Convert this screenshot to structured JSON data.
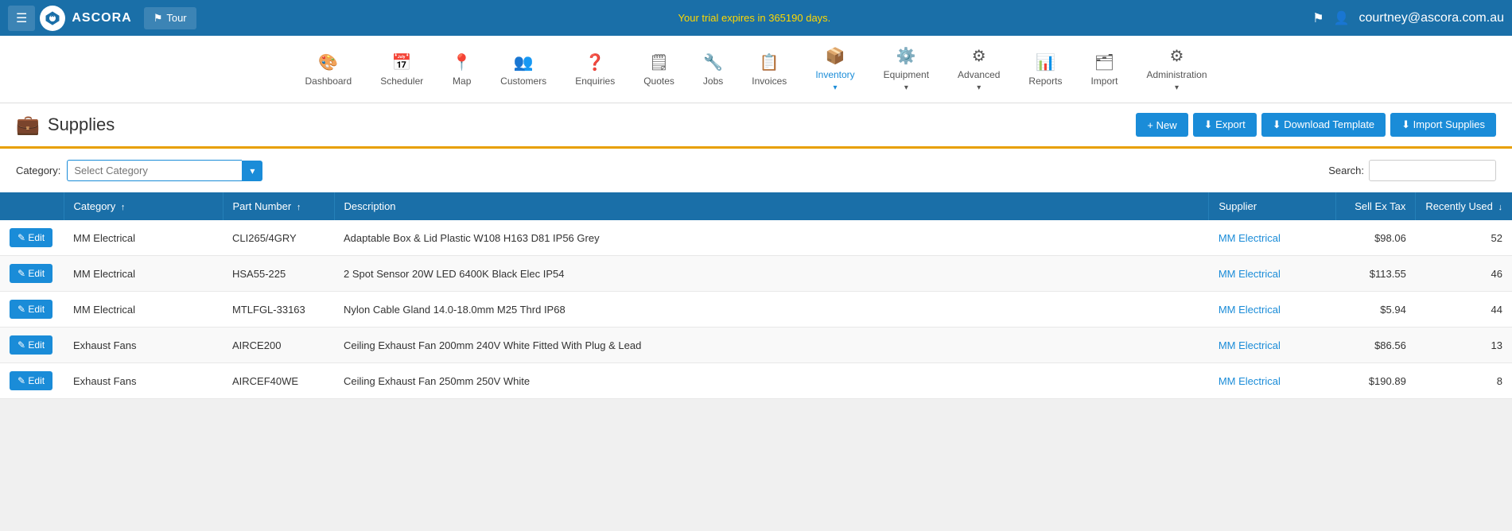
{
  "topnav": {
    "logo_text": "Ascora",
    "hamburger_label": "☰",
    "tour_label": "Tour",
    "trial_notice": "Your trial expires in 365190 days.",
    "flag_icon": "⚑",
    "user_icon": "👤",
    "user_email": "courtney@ascora.com.au"
  },
  "secondnav": {
    "items": [
      {
        "id": "dashboard",
        "icon": "🎨",
        "label": "Dashboard",
        "active": false,
        "dropdown": false
      },
      {
        "id": "scheduler",
        "icon": "📅",
        "label": "Scheduler",
        "active": false,
        "dropdown": false
      },
      {
        "id": "map",
        "icon": "📍",
        "label": "Map",
        "active": false,
        "dropdown": false
      },
      {
        "id": "customers",
        "icon": "👥",
        "label": "Customers",
        "active": false,
        "dropdown": false
      },
      {
        "id": "enquiries",
        "icon": "❓",
        "label": "Enquiries",
        "active": false,
        "dropdown": false
      },
      {
        "id": "quotes",
        "icon": "🗒",
        "label": "Quotes",
        "active": false,
        "dropdown": false
      },
      {
        "id": "jobs",
        "icon": "🔧",
        "label": "Jobs",
        "active": false,
        "dropdown": false
      },
      {
        "id": "invoices",
        "icon": "📋",
        "label": "Invoices",
        "active": false,
        "dropdown": false
      },
      {
        "id": "inventory",
        "icon": "📦",
        "label": "Inventory",
        "active": true,
        "dropdown": true
      },
      {
        "id": "equipment",
        "icon": "⚙️",
        "label": "Equipment",
        "active": false,
        "dropdown": true
      },
      {
        "id": "advanced",
        "icon": "⚙",
        "label": "Advanced",
        "active": false,
        "dropdown": true
      },
      {
        "id": "reports",
        "icon": "📊",
        "label": "Reports",
        "active": false,
        "dropdown": false
      },
      {
        "id": "import",
        "icon": "🗂",
        "label": "Import",
        "active": false,
        "dropdown": false
      },
      {
        "id": "administration",
        "icon": "⚙",
        "label": "Administration",
        "active": false,
        "dropdown": true
      }
    ]
  },
  "page": {
    "title": "Supplies",
    "title_icon": "💼"
  },
  "buttons": {
    "new_label": "+ New",
    "export_label": "⬇ Export",
    "download_template_label": "⬇ Download Template",
    "import_supplies_label": "⬇ Import Supplies"
  },
  "filter": {
    "category_label": "Category:",
    "category_placeholder": "Select Category",
    "search_label": "Search:",
    "search_value": ""
  },
  "table": {
    "columns": [
      {
        "id": "edit",
        "label": ""
      },
      {
        "id": "category",
        "label": "Category",
        "sort": "asc"
      },
      {
        "id": "part_number",
        "label": "Part Number",
        "sort": "asc"
      },
      {
        "id": "description",
        "label": "Description",
        "sort": null
      },
      {
        "id": "supplier",
        "label": "Supplier",
        "sort": null
      },
      {
        "id": "sell_ex_tax",
        "label": "Sell Ex Tax",
        "sort": null
      },
      {
        "id": "recently_used",
        "label": "Recently Used",
        "sort": "desc"
      }
    ],
    "rows": [
      {
        "id": 1,
        "category": "MM Electrical",
        "part_number": "CLI265/4GRY",
        "description": "Adaptable Box & Lid Plastic W108 H163 D81 IP56 Grey",
        "supplier": "MM Electrical",
        "sell_ex_tax": "$98.06",
        "recently_used": "52"
      },
      {
        "id": 2,
        "category": "MM Electrical",
        "part_number": "HSA55-225",
        "description": "2 Spot Sensor 20W LED 6400K Black Elec IP54",
        "supplier": "MM Electrical",
        "sell_ex_tax": "$113.55",
        "recently_used": "46"
      },
      {
        "id": 3,
        "category": "MM Electrical",
        "part_number": "MTLFGL-33163",
        "description": "Nylon Cable Gland 14.0-18.0mm M25 Thrd IP68",
        "supplier": "MM Electrical",
        "sell_ex_tax": "$5.94",
        "recently_used": "44"
      },
      {
        "id": 4,
        "category": "Exhaust Fans",
        "part_number": "AIRCE200",
        "description": "Ceiling Exhaust Fan 200mm 240V White Fitted With Plug & Lead",
        "supplier": "MM Electrical",
        "sell_ex_tax": "$86.56",
        "recently_used": "13"
      },
      {
        "id": 5,
        "category": "Exhaust Fans",
        "part_number": "AIRCEF40WE",
        "description": "Ceiling Exhaust Fan 250mm 250V White",
        "supplier": "MM Electrical",
        "sell_ex_tax": "$190.89",
        "recently_used": "8"
      }
    ],
    "edit_btn_label": "✎ Edit"
  }
}
